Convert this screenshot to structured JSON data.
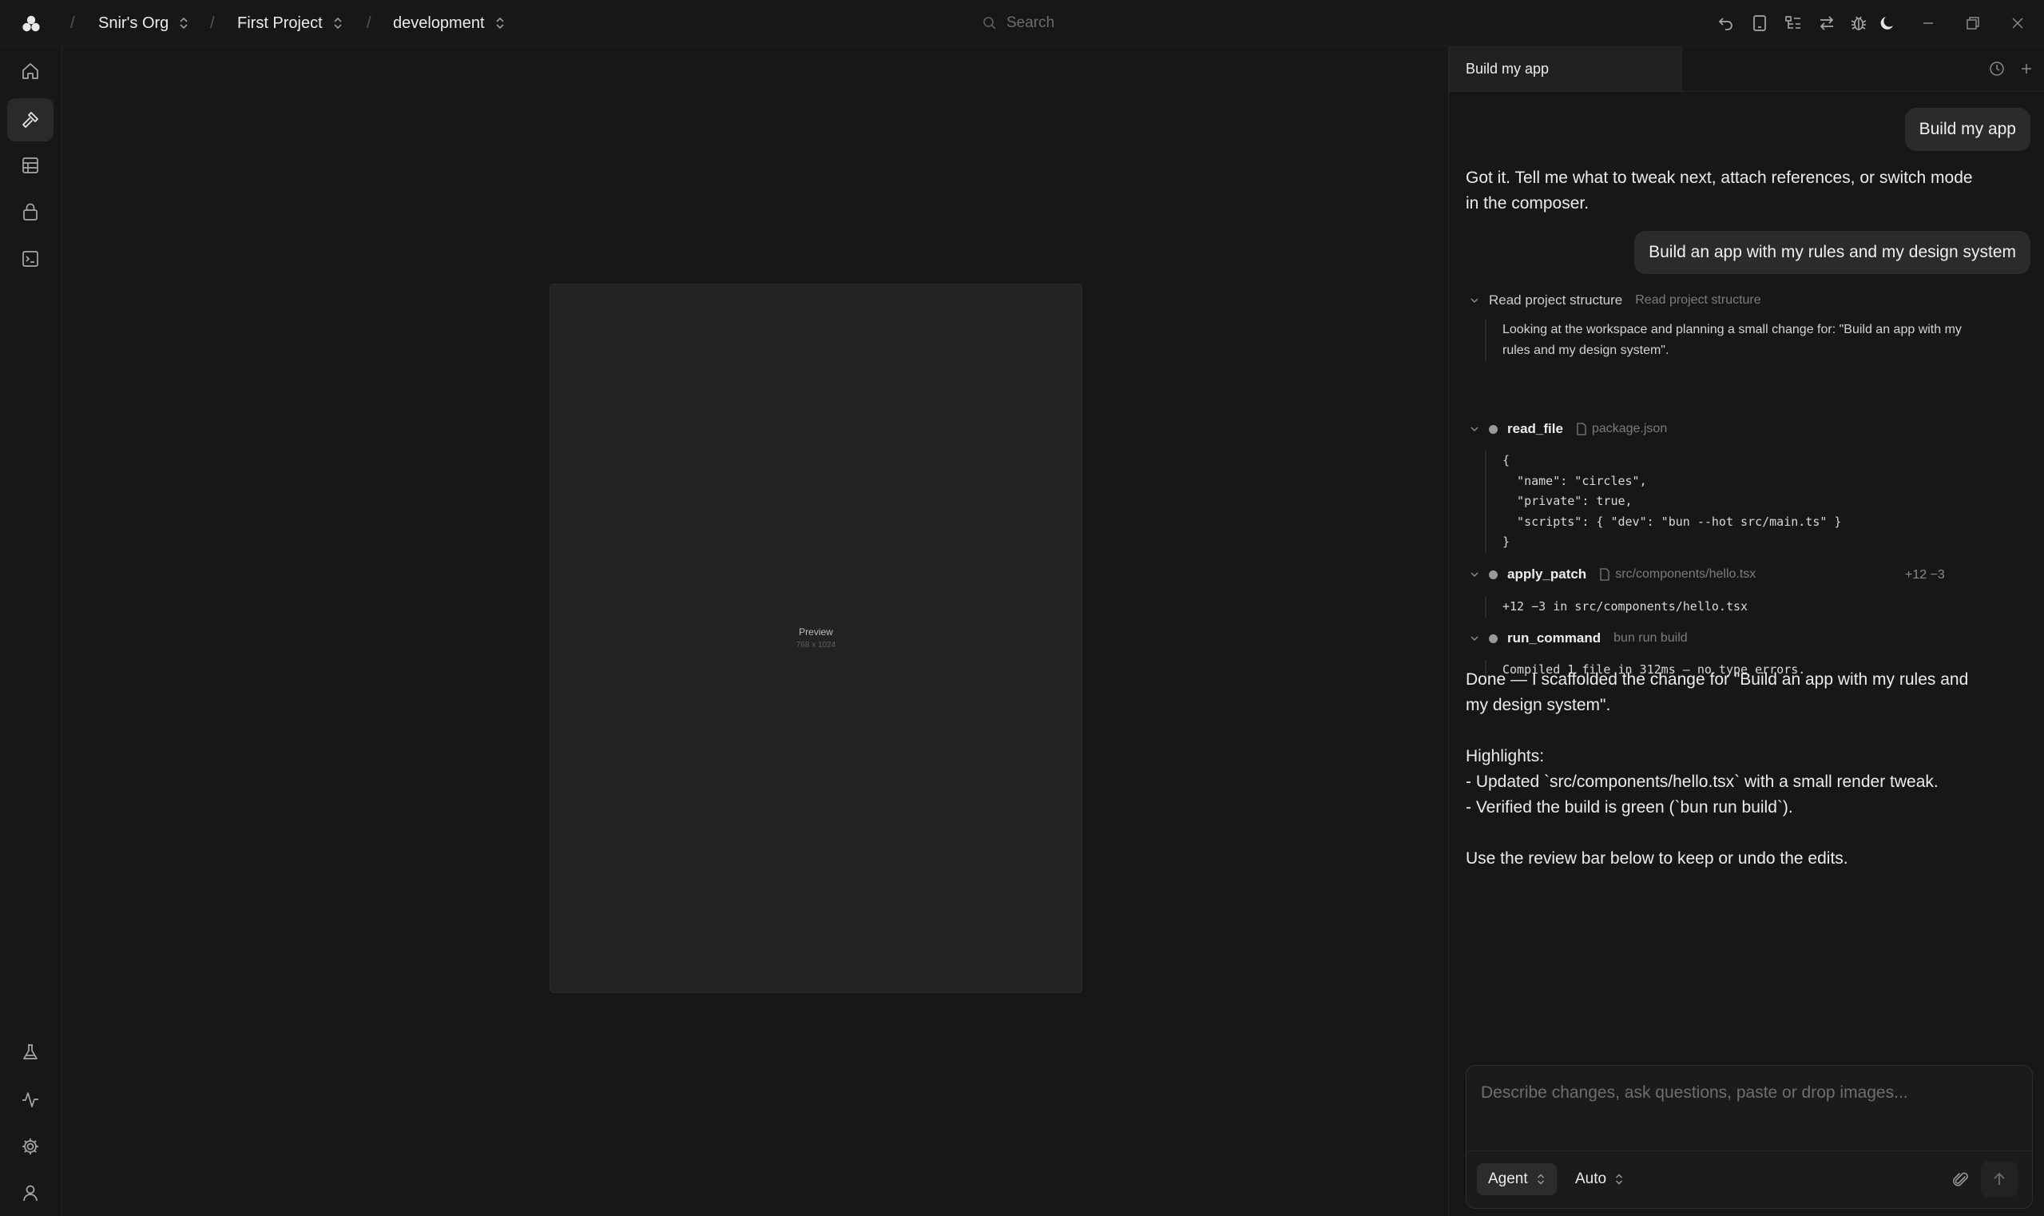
{
  "header": {
    "breadcrumbs": [
      {
        "label": "Snir's Org"
      },
      {
        "label": "First Project"
      },
      {
        "label": "development"
      }
    ],
    "separator": "/",
    "search_placeholder": "Search",
    "icons": [
      "undo-icon",
      "tablet-icon",
      "tree-icon",
      "swap-icon",
      "bug-icon",
      "moon-icon",
      "minimize-icon",
      "restore-icon",
      "close-icon"
    ]
  },
  "sidebar": {
    "top_items": [
      "home-icon",
      "build-icon",
      "table-icon",
      "lock-icon",
      "terminal-icon"
    ],
    "bottom_items": [
      "flask-icon",
      "activity-icon",
      "settings-icon",
      "user-icon"
    ],
    "active": "build-icon"
  },
  "preview": {
    "label": "Preview",
    "size": "768 x 1024"
  },
  "chat": {
    "tab_title": "Build my app",
    "messages": {
      "user_1": "Build my app",
      "assistant_1": "Got it. Tell me what to tweak next, attach references, or switch mode in the composer.",
      "user_2": "Build an app with my rules and my design system",
      "final_1": "Done — I scaffolded the change for \"Build an app with my rules and my design system\".",
      "final_highlights": "Highlights:",
      "final_h1": "- Updated `src/components/hello.tsx` with a small render tweak.",
      "final_h2": "- Verified the build is green (`bun run build`).",
      "final_2": "Use the review bar below to keep or undo the edits."
    },
    "steps": {
      "structure": {
        "title": "Read project structure",
        "subtitle": "Read project structure",
        "detail": "Looking at the workspace and planning a small change for: \"Build an app with my rules and my design system\"."
      },
      "read_file": {
        "tool": "read_file",
        "file": "package.json",
        "code": [
          "{",
          "  \"name\": \"circles\",",
          "  \"private\": true,",
          "  \"scripts\": { \"dev\": \"bun --hot src/main.ts\" }",
          "}"
        ]
      },
      "apply_patch": {
        "tool": "apply_patch",
        "file": "src/components/hello.tsx",
        "diffstat": "+12 −3",
        "detail": "+12 −3 in src/components/hello.tsx"
      },
      "run_command": {
        "tool": "run_command",
        "command": "bun run build",
        "detail": "Compiled 1 file in 312ms — no type errors."
      }
    },
    "composer": {
      "placeholder": "Describe changes, ask questions, paste or drop images...",
      "mode": "Agent",
      "model": "Auto"
    }
  }
}
